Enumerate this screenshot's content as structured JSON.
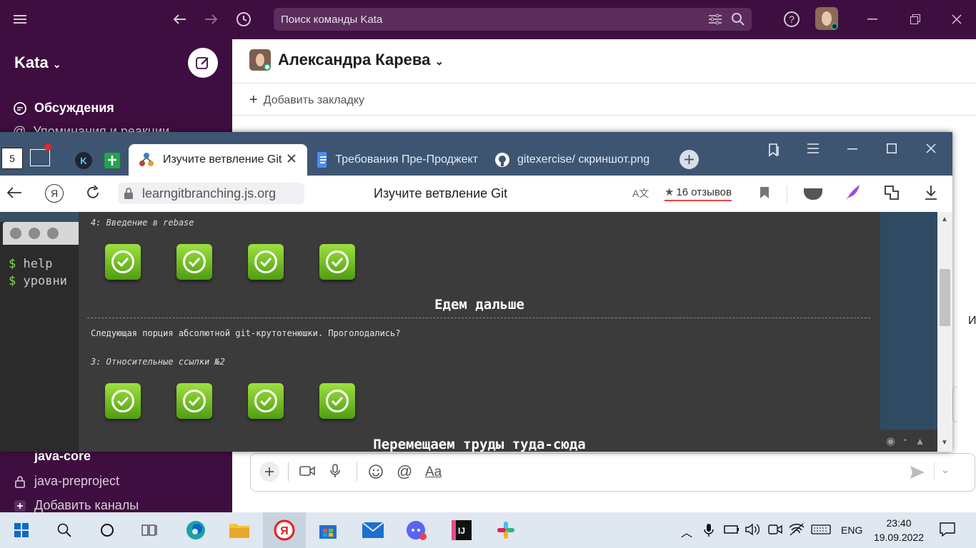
{
  "slack": {
    "search_placeholder": "Поиск команды Kata",
    "workspace": "Kata",
    "sidebar": {
      "threads": "Обсуждения",
      "mentions": "Упоминания и реакции",
      "channel_core": "java-core",
      "channel_preproject": "java-preproject",
      "add_channels": "Добавить каналы"
    },
    "channel_title": "Александра Карева",
    "add_bookmark": "Добавить закладку",
    "composer_format": "Aa"
  },
  "browser": {
    "tab_badge": "5",
    "tabs": [
      {
        "label": "Изучите ветвление Git"
      },
      {
        "label": "Требования Пре-Проджект"
      },
      {
        "label": "gitexercise/ скриншот.png"
      }
    ],
    "url": "learngitbranching.js.org",
    "page_title": "Изучите ветвление Git",
    "reviews": "16 отзывов"
  },
  "terminal": {
    "prompt": "$",
    "lines": [
      "help",
      "уровни"
    ]
  },
  "levels": {
    "level4_title": "4: Введение в rebase",
    "section1_title": "Едем дальше",
    "section1_desc": "Следующая порция абсолютной git-крутотенюшки. Проголодались?",
    "level3_title": "3: Относительные ссылки №2",
    "section2_title": "Перемещаем труды туда-сюда",
    "partial_char": "И"
  },
  "taskbar": {
    "lang": "ENG",
    "time": "23:40",
    "date": "19.09.2022"
  },
  "colors": {
    "slack_aubergine": "#3f0e40",
    "browser_chrome": "#3e5572",
    "level_bg": "#3b3b3b",
    "check_green": "#6cc024"
  }
}
